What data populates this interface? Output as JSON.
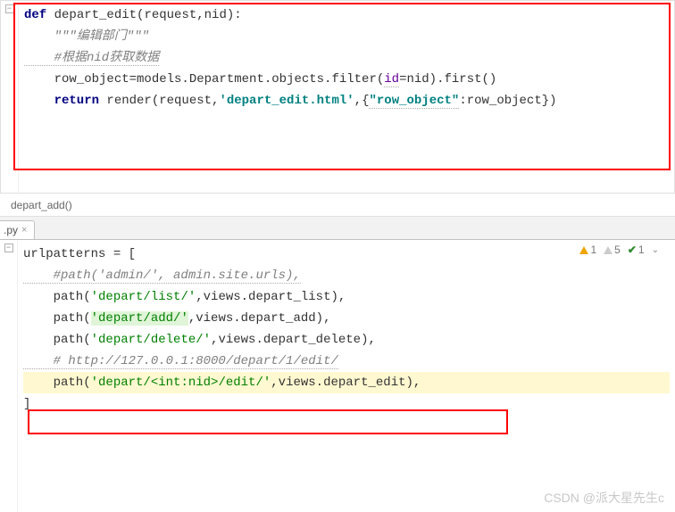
{
  "top": {
    "l1_def": "def",
    "l1_fn": " depart_edit",
    "l1_rest": "(request,nid):",
    "l2_doc": "    \"\"\"编辑部门\"\"\"",
    "l3_comment": "    #根据nid获取数据",
    "l4_a": "    row_object=models.Department.objects.filter(",
    "l4_id": "id",
    "l4_b": "=nid).first()",
    "l5_blank": "",
    "l6_ret": "    return",
    "l6_render": " render(request,",
    "l6_str": "'depart_edit.html'",
    "l6_mid": ",{",
    "l6_key": "\"row_object\"",
    "l6_end": ":row_object})"
  },
  "breadcrumb": "depart_add()",
  "tab": {
    "label": ".py",
    "close": "×"
  },
  "bottom": {
    "l1": "urlpatterns = [",
    "l2_c": "    #path('admin/', admin.site.urls),",
    "l3_a": "    path(",
    "l3_s": "'depart/list/'",
    "l3_b": ",views.depart_list),",
    "l4_a": "    path(",
    "l4_s": "'depart/add/'",
    "l4_b": ",views.depart_add),",
    "l5_a": "    path(",
    "l5_s": "'depart/delete/'",
    "l5_b": ",views.depart_delete),",
    "l6_blank": "",
    "l7_c": "    # http://127.0.0.1:8000/depart/1/edit/",
    "l8_a": "    path(",
    "l8_s": "'depart/<int:nid>/edit/'",
    "l8_b": ",views.depart_edit),",
    "l9": "]"
  },
  "badges": {
    "warn": "1",
    "mute": "5",
    "check": "1"
  },
  "watermark": "CSDN @派大星先生c"
}
